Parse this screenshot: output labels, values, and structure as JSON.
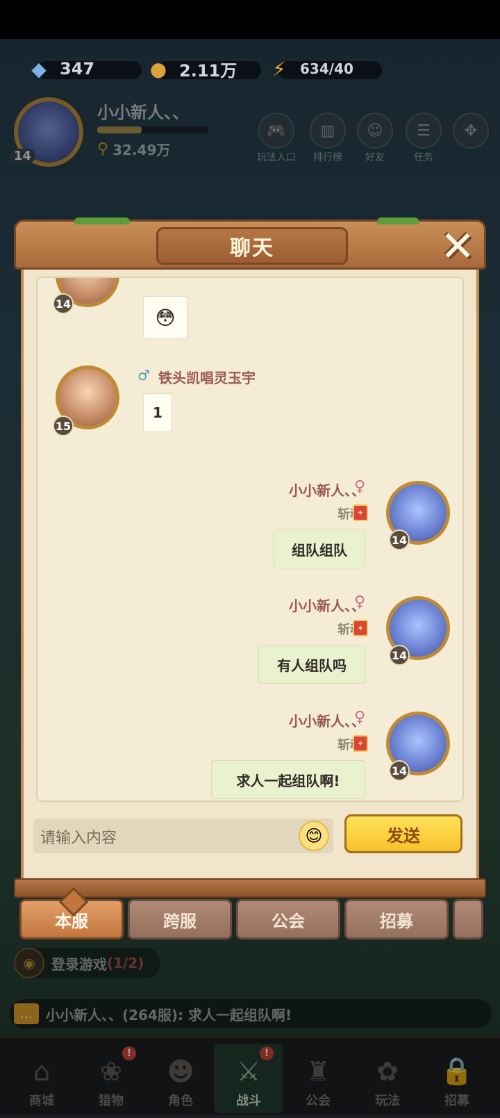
{
  "hud": {
    "diamonds": "347",
    "gold": "2.11万",
    "energy": "634/40",
    "player_name": "小小新人、、",
    "player_level": "14",
    "power": "32.49万",
    "menu": [
      {
        "label": "玩法入口",
        "icon": "gamepad-icon"
      },
      {
        "label": "排行榜",
        "icon": "ranking-icon"
      },
      {
        "label": "好友",
        "icon": "friends-icon"
      },
      {
        "label": "任务",
        "icon": "task-icon"
      },
      {
        "label": "",
        "icon": "more-icon"
      }
    ]
  },
  "dialog": {
    "title": "聊天",
    "messages": [
      {
        "level": "14",
        "content": "😳"
      },
      {
        "level": "15",
        "name": "铁头凯唱灵玉宇",
        "content": "1"
      },
      {
        "level": "14",
        "name": "小小新人、、",
        "title": "斩魂",
        "content": "组队组队"
      },
      {
        "level": "14",
        "name": "小小新人、、",
        "title": "斩魂",
        "content": "有人组队吗"
      },
      {
        "level": "14",
        "name": "小小新人、、",
        "title": "斩魂",
        "content": "求人一起组队啊!"
      }
    ],
    "input_placeholder": "请输入内容",
    "send_label": "发送",
    "tabs": [
      "本服",
      "跨服",
      "公会",
      "招募"
    ]
  },
  "quest": {
    "text": "登录游戏",
    "progress": "(1/2)"
  },
  "ticker": {
    "text": "小小新人、、(264服): 求人一起组队啊!"
  },
  "nav": [
    {
      "label": "商城"
    },
    {
      "label": "猎物"
    },
    {
      "label": "角色"
    },
    {
      "label": "战斗"
    },
    {
      "label": "公会"
    },
    {
      "label": "玩法"
    },
    {
      "label": "招募"
    }
  ],
  "colors": {
    "accent_gold": "#f7c22a",
    "wood": "#a86a3b",
    "parchment": "#f1e6cc",
    "name_color": "#9c5a52",
    "my_bubble": "#e9f1cf"
  }
}
